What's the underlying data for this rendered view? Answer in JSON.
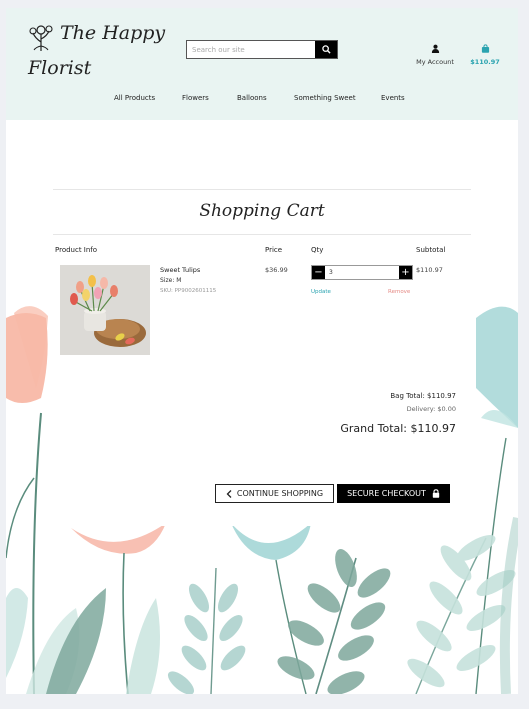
{
  "header": {
    "logo_line1": "The Happy",
    "logo_line2": "Florist",
    "search_placeholder": "Search our site",
    "account_label": "My Account",
    "cart_total": "$110.97"
  },
  "nav": [
    "All Products",
    "Flowers",
    "Balloons",
    "Something Sweet",
    "Events"
  ],
  "cart": {
    "title": "Shopping Cart",
    "columns": {
      "product": "Product Info",
      "price": "Price",
      "qty": "Qty",
      "subtotal": "Subtotal"
    },
    "item": {
      "name": "Sweet Tulips",
      "size_label": "Size:",
      "size_value": "M",
      "sku": "SKU: PP9002601115",
      "price": "$36.99",
      "quantity": "3",
      "update": "Update",
      "remove": "Remove",
      "subtotal": "$110.97"
    },
    "bag_total": "Bag Total: $110.97",
    "delivery": "Delivery: $0.00",
    "grand_total": "Grand Total: $110.97",
    "continue_label": "CONTINUE SHOPPING",
    "checkout_label": "SECURE CHECKOUT"
  },
  "colors": {
    "header_bg": "#e9f4f2",
    "accent": "#2aa3b0",
    "remove": "#e58a85"
  },
  "icons": [
    "flower-logo-icon",
    "search-icon",
    "user-icon",
    "shopping-bag-icon",
    "minus-icon",
    "plus-icon",
    "chevron-left-icon",
    "lock-icon"
  ]
}
